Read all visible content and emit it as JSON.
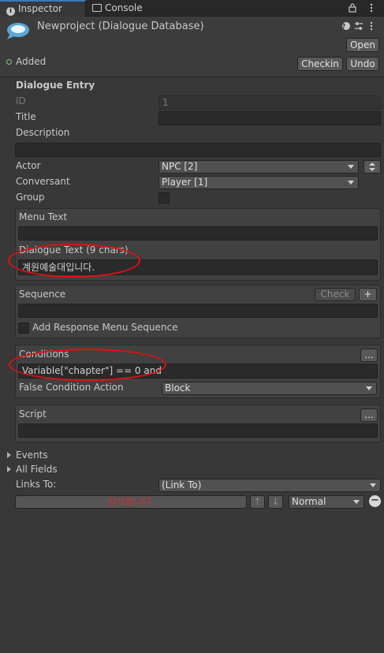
{
  "tabs": {
    "inspector": "Inspector",
    "console": "Console"
  },
  "tab_icons": "⌂ ⋮",
  "header": {
    "title": "Newproject (Dialogue Database)",
    "logo_text": "DS",
    "open_label": "Open",
    "status": "Added",
    "checkin_label": "Checkin",
    "undo_label": "Undo"
  },
  "entry": {
    "section_title": "Dialogue Entry",
    "id_label": "ID",
    "id_value": "1",
    "title_label": "Title",
    "title_value": "",
    "description_label": "Description",
    "description_value": "",
    "actor_label": "Actor",
    "actor_value": "NPC [2]",
    "conversant_label": "Conversant",
    "conversant_value": "Player [1]",
    "group_label": "Group",
    "menu_text_label": "Menu Text",
    "menu_text_value": "",
    "dialogue_text_label": "Dialogue Text (9 chars)",
    "dialogue_text_value": "계원예술대입니다.",
    "sequence_label": "Sequence",
    "check_label": "Check",
    "plus_label": "+",
    "add_response_label": "Add Response Menu Sequence",
    "sequence_value": "",
    "conditions_label": "Conditions",
    "ellipsis_label": "...",
    "conditions_value": "Variable[\"chapter\"] == 0 and",
    "false_condition_label": "False Condition Action",
    "false_condition_value": "Block",
    "script_label": "Script",
    "script_value": "",
    "events_label": "Events",
    "all_fields_label": "All Fields",
    "links_to_label": "Links To:",
    "links_to_value": "(Link To)",
    "link_entry_text": "감사합니다.",
    "link_up": "↑",
    "link_down": "↓",
    "link_priority": "Normal",
    "link_remove": "−"
  },
  "colors": {
    "background": "#383838",
    "highlight_red": "#e01010",
    "link_text_red": "#d03030",
    "added_green": "#7fcc7f"
  }
}
